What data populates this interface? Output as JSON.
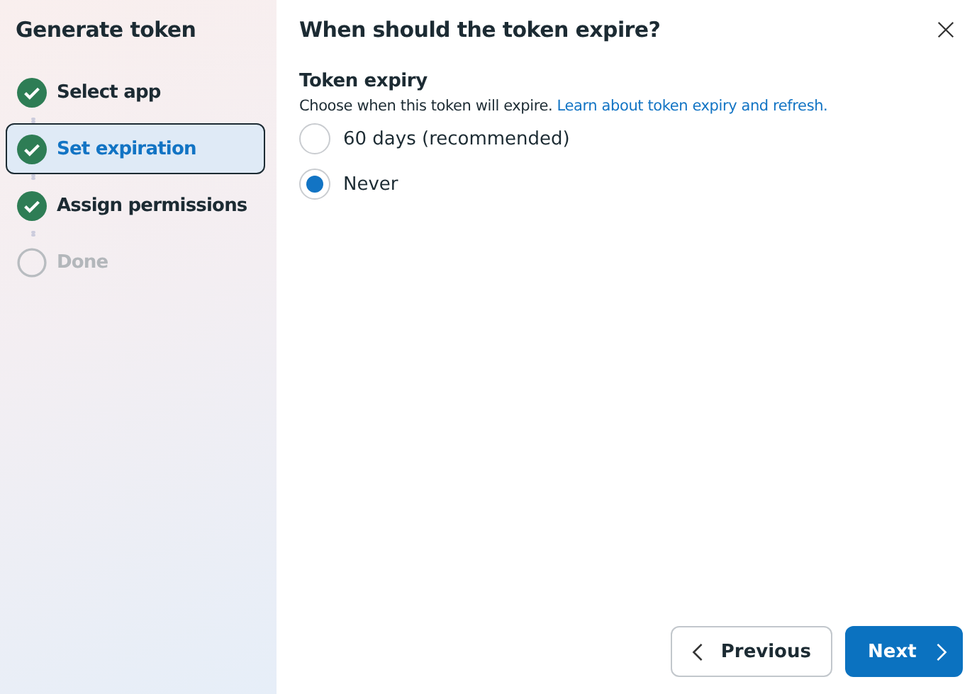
{
  "sidebar": {
    "title": "Generate token",
    "steps": [
      {
        "label": "Select app",
        "completed": true,
        "selected": false
      },
      {
        "label": "Set expiration",
        "completed": true,
        "selected": true
      },
      {
        "label": "Assign permissions",
        "completed": true,
        "selected": false
      },
      {
        "label": "Done",
        "completed": false,
        "selected": false
      }
    ]
  },
  "dialog": {
    "title": "When should the token expire?",
    "section_title": "Token expiry",
    "description": "Choose when this token will expire.",
    "link": "Learn about token expiry and refresh.",
    "options": [
      {
        "label": "60 days (recommended)",
        "selected": false
      },
      {
        "label": "Never",
        "selected": true
      }
    ]
  },
  "buttons": [
    {
      "label": "Previous",
      "kind": "secondary"
    },
    {
      "label": "Next",
      "kind": "primary"
    }
  ]
}
